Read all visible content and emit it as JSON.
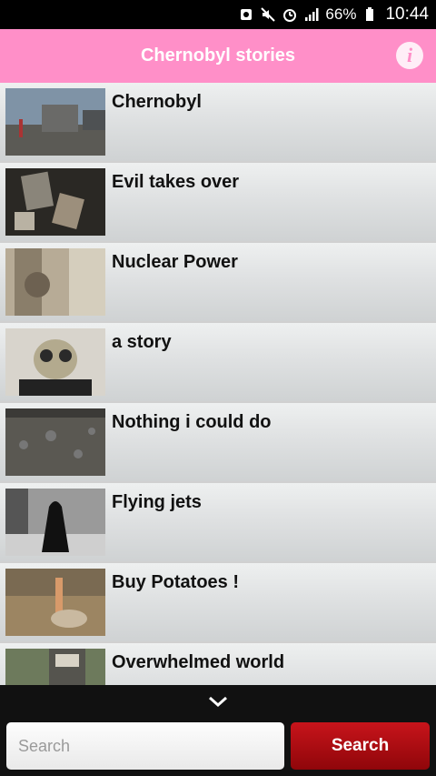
{
  "status_bar": {
    "battery_percent": "66%",
    "time": "10:44",
    "icons": [
      "notification-icon",
      "mute-vibrate-icon",
      "alarm-icon",
      "signal-icon",
      "battery-icon"
    ]
  },
  "header": {
    "title": "Chernobyl stories",
    "info_icon": "info-icon"
  },
  "stories": [
    {
      "title": "Chernobyl"
    },
    {
      "title": "Evil takes over"
    },
    {
      "title": "Nuclear Power"
    },
    {
      "title": "a story"
    },
    {
      "title": "Nothing i could do"
    },
    {
      "title": "Flying jets"
    },
    {
      "title": "Buy Potatoes !"
    },
    {
      "title": "Overwhelmed world"
    }
  ],
  "footer": {
    "expand_icon": "chevron-down-icon",
    "search_placeholder": "Search",
    "search_button_label": "Search"
  },
  "colors": {
    "header": "#ff8fc8",
    "search_button": "#b00d13"
  }
}
